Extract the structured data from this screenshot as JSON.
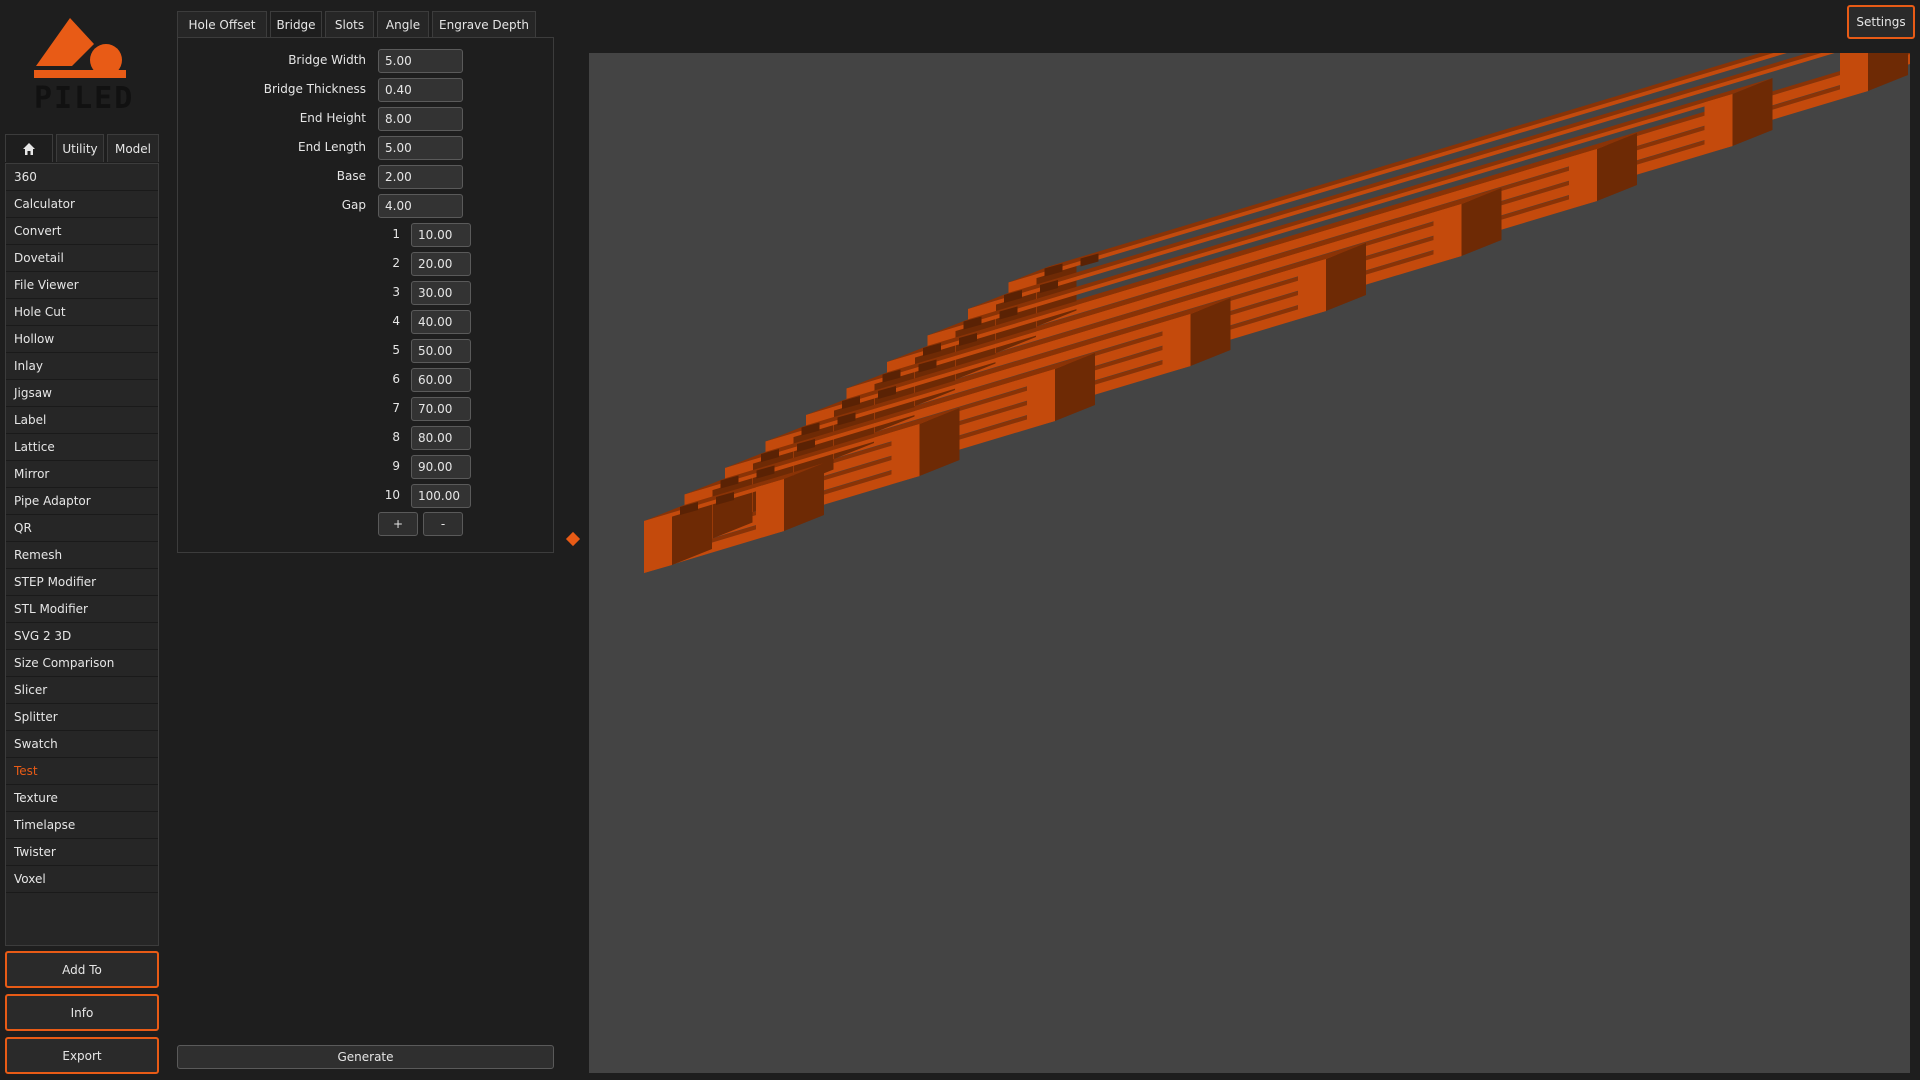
{
  "app": {
    "logo_text": "PILED",
    "brand_color": "#e85b16"
  },
  "nav_tabs": [
    {
      "label": "",
      "icon": "home-icon",
      "active": true
    },
    {
      "label": "Utility",
      "active": false
    },
    {
      "label": "Model",
      "active": false
    }
  ],
  "tools": [
    "360",
    "Calculator",
    "Convert",
    "Dovetail",
    "File Viewer",
    "Hole Cut",
    "Hollow",
    "Inlay",
    "Jigsaw",
    "Label",
    "Lattice",
    "Mirror",
    "Pipe Adaptor",
    "QR",
    "Remesh",
    "STEP Modifier",
    "STL Modifier",
    "SVG 2 3D",
    "Size Comparison",
    "Slicer",
    "Splitter",
    "Swatch",
    "Test",
    "Texture",
    "Timelapse",
    "Twister",
    "Voxel"
  ],
  "active_tool": "Test",
  "side_buttons": {
    "add_to": "Add To",
    "info": "Info",
    "export": "Export"
  },
  "param_tabs": [
    {
      "label": "Hole Offset",
      "active": false
    },
    {
      "label": "Bridge",
      "active": true
    },
    {
      "label": "Slots",
      "active": false
    },
    {
      "label": "Angle",
      "active": false
    },
    {
      "label": "Engrave Depth",
      "active": false
    }
  ],
  "params": [
    {
      "label": "Bridge Width",
      "value": "5.00"
    },
    {
      "label": "Bridge Thickness",
      "value": "0.40"
    },
    {
      "label": "End Height",
      "value": "8.00"
    },
    {
      "label": "End Length",
      "value": "5.00"
    },
    {
      "label": "Base",
      "value": "2.00"
    },
    {
      "label": "Gap",
      "value": "4.00"
    }
  ],
  "lengths": [
    {
      "index": "1",
      "value": "10.00"
    },
    {
      "index": "2",
      "value": "20.00"
    },
    {
      "index": "3",
      "value": "30.00"
    },
    {
      "index": "4",
      "value": "40.00"
    },
    {
      "index": "5",
      "value": "50.00"
    },
    {
      "index": "6",
      "value": "60.00"
    },
    {
      "index": "7",
      "value": "70.00"
    },
    {
      "index": "8",
      "value": "80.00"
    },
    {
      "index": "9",
      "value": "90.00"
    },
    {
      "index": "10",
      "value": "100.00"
    }
  ],
  "list_buttons": {
    "add": "+",
    "remove": "-"
  },
  "generate_label": "Generate",
  "settings_label": "Settings",
  "model_colors": {
    "front": "#c44a0c",
    "top": "#8a3306",
    "side": "#6e2a05",
    "dark": "#5a2204",
    "background": "#444444"
  }
}
